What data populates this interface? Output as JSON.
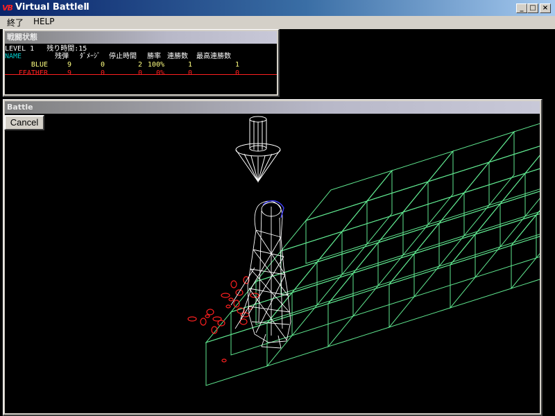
{
  "app": {
    "icon_text": "VB",
    "title": "Virtual BattleⅡ",
    "controls": {
      "minimize": "_",
      "maximize": "□",
      "close": "×"
    }
  },
  "menu": {
    "items": [
      "終了",
      "HELP"
    ]
  },
  "status_window": {
    "title": "戦闘状態",
    "level_line": "LEVEL 1   残り時間:15",
    "headers": [
      "NAME",
      "残弾",
      "ﾀﾞﾒｰｼﾞ",
      "停止時間",
      "勝率",
      "連勝数",
      "最高連勝数"
    ],
    "rows": [
      {
        "name": "BLUE",
        "ammo": "9",
        "damage": "0",
        "stop": "2",
        "win_rate": "100%",
        "streak": "1",
        "best_streak": "1",
        "color": "#ffff80"
      },
      {
        "name": "FEATHER",
        "ammo": "9",
        "damage": "0",
        "stop": "0",
        "win_rate": "0%",
        "streak": "0",
        "best_streak": "0",
        "color": "#ff2020"
      }
    ],
    "header_color": "#00c8c8",
    "text_color": "#ffffff"
  },
  "battle_window": {
    "title": "Battle",
    "cancel_label": "Cancel"
  },
  "scene_colors": {
    "blocks": "#60e890",
    "character": "#ffffff",
    "character_accent": "#4040ff",
    "marker": "#ffffff",
    "particles": "#ff2020"
  }
}
